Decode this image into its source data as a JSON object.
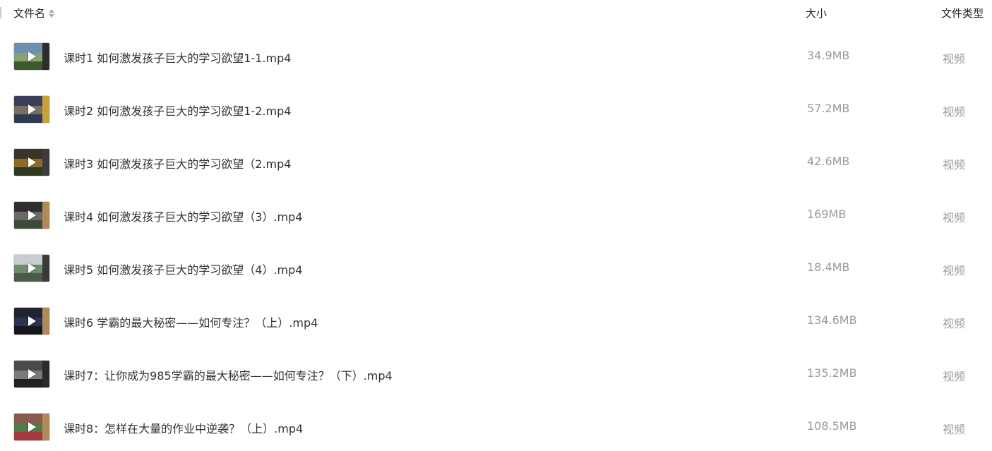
{
  "header": {
    "name_label": "文件名",
    "size_label": "大小",
    "type_label": "文件类型"
  },
  "files": [
    {
      "name": "课时1 如何激发孩子巨大的学习欲望1-1.mp4",
      "size": "34.9MB",
      "type": "视频",
      "thumb_colors": [
        "#6d8fb0",
        "#8aa36c",
        "#3c5a2e",
        "#2d2d2d"
      ]
    },
    {
      "name": "课时2 如何激发孩子巨大的学习欲望1-2.mp4",
      "size": "57.2MB",
      "type": "视频",
      "thumb_colors": [
        "#3a3f5a",
        "#7a6f62",
        "#2f3b52",
        "#c9a13a"
      ]
    },
    {
      "name": "课时3 如何激发孩子巨大的学习欲望（2.mp4",
      "size": "42.6MB",
      "type": "视频",
      "thumb_colors": [
        "#3b3526",
        "#8c6a2a",
        "#2c3a1f",
        "#3d3d3d"
      ]
    },
    {
      "name": "课时4 如何激发孩子巨大的学习欲望（3）.mp4",
      "size": "169MB",
      "type": "视频",
      "thumb_colors": [
        "#2f2f2f",
        "#6a6a6a",
        "#3f4a3a",
        "#b08a5c"
      ]
    },
    {
      "name": "课时5 如何激发孩子巨大的学习欲望（4）.mp4",
      "size": "18.4MB",
      "type": "视频",
      "thumb_colors": [
        "#c8cdd1",
        "#6f8d6a",
        "#4b5a4a",
        "#3a3a3a"
      ]
    },
    {
      "name": "课时6 学霸的最大秘密——如何专注？（上）.mp4",
      "size": "134.6MB",
      "type": "视频",
      "thumb_colors": [
        "#1f2433",
        "#2c3350",
        "#151820",
        "#b08a5c"
      ]
    },
    {
      "name": "课时7：让你成为985学霸的最大秘密——如何专注？（下）.mp4",
      "size": "135.2MB",
      "type": "视频",
      "thumb_colors": [
        "#4a4a4a",
        "#7a7a7a",
        "#222222",
        "#2a2a2a"
      ]
    },
    {
      "name": "课时8：怎样在大量的作业中逆袭？（上）.mp4",
      "size": "108.5MB",
      "type": "视频",
      "thumb_colors": [
        "#8a5a4a",
        "#4f7a4a",
        "#a33a3a",
        "#b08a5c"
      ]
    }
  ]
}
